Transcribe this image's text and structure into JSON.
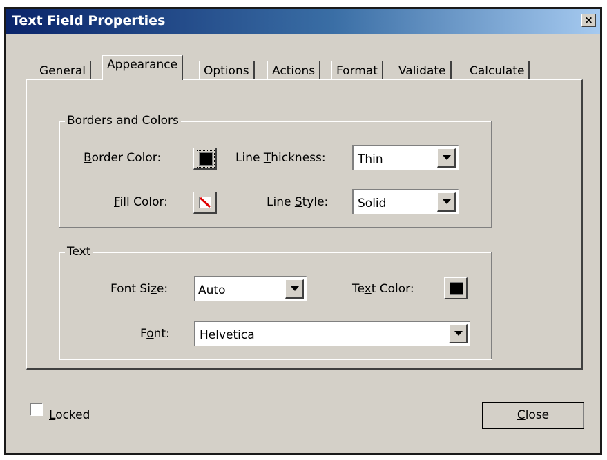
{
  "window": {
    "title": "Text Field Properties",
    "close_glyph": "×"
  },
  "tabs": [
    {
      "label": "General"
    },
    {
      "label": "Appearance",
      "active": true
    },
    {
      "label": "Options"
    },
    {
      "label": "Actions"
    },
    {
      "label": "Format"
    },
    {
      "label": "Validate"
    },
    {
      "label": "Calculate"
    }
  ],
  "borders_group": {
    "legend": "Borders and Colors",
    "border_color_label": {
      "mnemonic": "B",
      "rest": "order Color:"
    },
    "fill_color_label": {
      "mnemonic": "F",
      "rest": "ill Color:"
    },
    "line_thickness_label": {
      "before": "Line ",
      "mnemonic": "T",
      "rest": "hickness:"
    },
    "line_thickness_value": "Thin",
    "line_style_label": {
      "before": "Line ",
      "mnemonic": "S",
      "rest": "tyle:"
    },
    "line_style_value": "Solid",
    "border_color": "#000000",
    "fill_color": "none"
  },
  "text_group": {
    "legend": "Text",
    "font_size_label": {
      "before": "Font Si",
      "mnemonic": "z",
      "rest": "e:"
    },
    "font_size_value": "Auto",
    "text_color_label": {
      "before": "Te",
      "mnemonic": "x",
      "rest": "t Color:"
    },
    "text_color": "#000000",
    "font_label": {
      "before": "F",
      "mnemonic": "o",
      "rest": "nt:"
    },
    "font_value": "Helvetica"
  },
  "footer": {
    "locked_label": {
      "mnemonic": "L",
      "rest": "ocked"
    },
    "locked_checked": false,
    "close_label": {
      "mnemonic": "C",
      "rest": "lose"
    }
  }
}
